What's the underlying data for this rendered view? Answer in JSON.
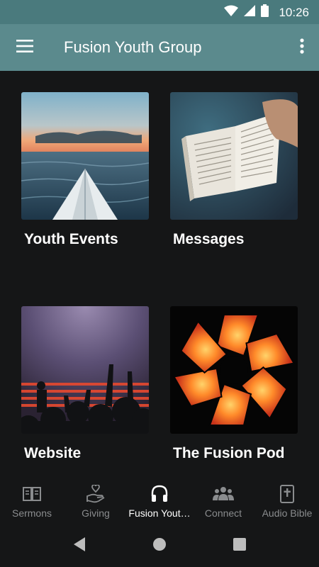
{
  "status_bar": {
    "time": "10:26",
    "icons": [
      "wifi-icon",
      "signal-icon",
      "battery-icon"
    ]
  },
  "app_bar": {
    "title": "Fusion Youth Group",
    "menu_icon": "hamburger-menu-icon",
    "more_icon": "more-vert-icon"
  },
  "tiles": [
    {
      "label": "Youth Events",
      "image": "kayak-on-lake-photo"
    },
    {
      "label": "Messages",
      "image": "open-bible-photo"
    },
    {
      "label": "Website",
      "image": "concert-crowd-photo"
    },
    {
      "label": "The Fusion Pod",
      "image": "fusion-pod-logo"
    }
  ],
  "bottom_nav": [
    {
      "label": "Sermons",
      "icon": "book-icon",
      "active": false
    },
    {
      "label": "Giving",
      "icon": "giving-hand-heart-icon",
      "active": false
    },
    {
      "label": "Fusion Yout…",
      "icon": "headphones-icon",
      "active": true
    },
    {
      "label": "Connect",
      "icon": "people-group-icon",
      "active": false
    },
    {
      "label": "Audio Bible",
      "icon": "bible-cross-icon",
      "active": false
    }
  ],
  "system_nav": [
    "back-icon",
    "home-icon",
    "recents-icon"
  ],
  "colors": {
    "status_bar": "#4a7a7d",
    "app_bar": "#5b8a8d",
    "background": "#151617",
    "nav_inactive": "#8a8c8e",
    "nav_active": "#ffffff"
  }
}
